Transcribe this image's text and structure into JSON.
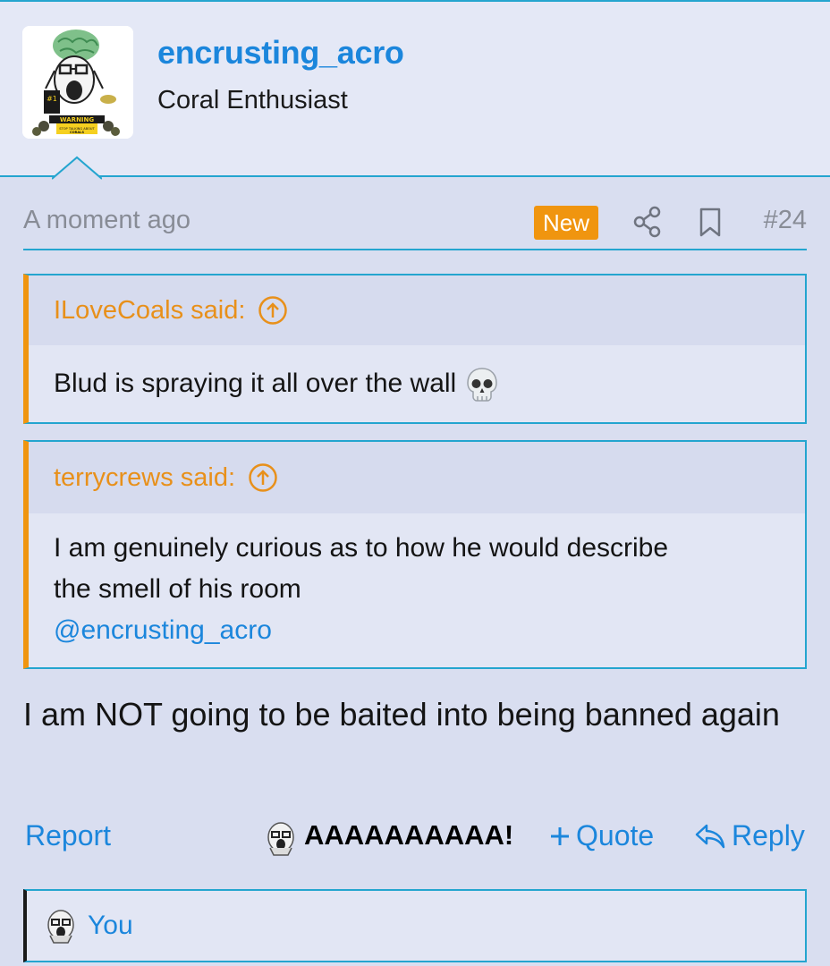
{
  "user": {
    "username": "encrusting_acro",
    "title": "Coral Enthusiast",
    "avatar": {
      "banner_text": "WARNING",
      "sign_text": "STOP TALKING ABOUT CORALS"
    }
  },
  "post": {
    "time": "A moment ago",
    "badge": "New",
    "share_icon": "share-icon",
    "bookmark_icon": "bookmark-icon",
    "number": "#24",
    "quotes": [
      {
        "author_line": "ILoveCoals said:",
        "lines": [
          "Blud is spraying it all over the wall"
        ],
        "emoji": "skull-icon"
      },
      {
        "author_line": "terrycrews said:",
        "lines": [
          "I am genuinely curious as to how he would describe",
          "the smell of his room"
        ],
        "mention": "@encrusting_acro"
      }
    ],
    "body": "I am NOT going to be baited into being banned again"
  },
  "actions": {
    "report": "Report",
    "reaction_label": "AAAAAAAAAA!",
    "quote": "Quote",
    "reply": "Reply"
  },
  "reply_box": {
    "you": "You"
  },
  "colors": {
    "accent": "#1b86dc",
    "border": "#24a5cf",
    "quote_accent": "#f0950f",
    "badge_new": "#f0950f",
    "background": "#d9def0"
  }
}
